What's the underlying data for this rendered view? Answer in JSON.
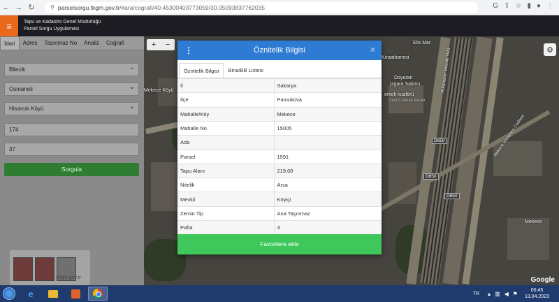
{
  "browser": {
    "url_host": "parselsorgu.tkgm.gov.tr",
    "url_path": "/#ara/cografi/40.45300403773059/30.05093837762035"
  },
  "header": {
    "org_line1": "Tapu ve Kadastro Genel Müdürlüğü",
    "org_line2": "Parsel Sorgu Uygulaması"
  },
  "sidebar": {
    "tabs": [
      {
        "label": "İdari"
      },
      {
        "label": "Adres"
      },
      {
        "label": "Taşınmaz No"
      },
      {
        "label": "Analiz"
      },
      {
        "label": "Coğrafi"
      }
    ],
    "province": "Bilecik",
    "district": "Osmaneli",
    "neighborhood": "Hisarcık Köyü",
    "block": "174",
    "parcel": "37",
    "query_button": "Sorgula"
  },
  "map": {
    "labels": {
      "kiraathanesi": "Kıraathanesi",
      "doyuran": "Doyuran",
      "izgara": "Izgara Salonu",
      "kuafor": "erkek kuaförü",
      "kuafor2": "Geçici olarak kapalı",
      "eli_mar": "Elis Mar",
      "mekece_koyu": "Mekece Köyü",
      "adapazari_bilecik": "Adapazarı Bilecik Yolu",
      "mekece_istasyon": "Mekece İstasyonu Caddesi",
      "mekece": "Mekece"
    },
    "road_shields": [
      "D650",
      "D650",
      "D650"
    ],
    "attribution": "Google"
  },
  "modal": {
    "title": "Öznitelik Bilgisi",
    "tabs": [
      "Öznitelik Bilgisi",
      "Bina/BB Listesi"
    ],
    "rows": [
      {
        "key": "İl",
        "value": "Sakarya"
      },
      {
        "key": "İlçe",
        "value": "Pamukova"
      },
      {
        "key": "Mahalle/Köy",
        "value": "Mekece"
      },
      {
        "key": "Mahalle No",
        "value": "15005"
      },
      {
        "key": "Ada",
        "value": ""
      },
      {
        "key": "Parsel",
        "value": "1591"
      },
      {
        "key": "Tapu Alanı",
        "value": "219,00"
      },
      {
        "key": "Nitelik",
        "value": "Arsa"
      },
      {
        "key": "Mevkii",
        "value": "Köyiçi"
      },
      {
        "key": "Zemin Tip",
        "value": "Ana Taşınmaz"
      },
      {
        "key": "Pafta",
        "value": "3"
      }
    ],
    "favorite_button": "Favorilere ekle"
  },
  "banner": {
    "email_fragment": "@gm.gov.tr"
  },
  "taskbar": {
    "language": "TR",
    "time": "00:45",
    "date": "13.04.2023"
  }
}
